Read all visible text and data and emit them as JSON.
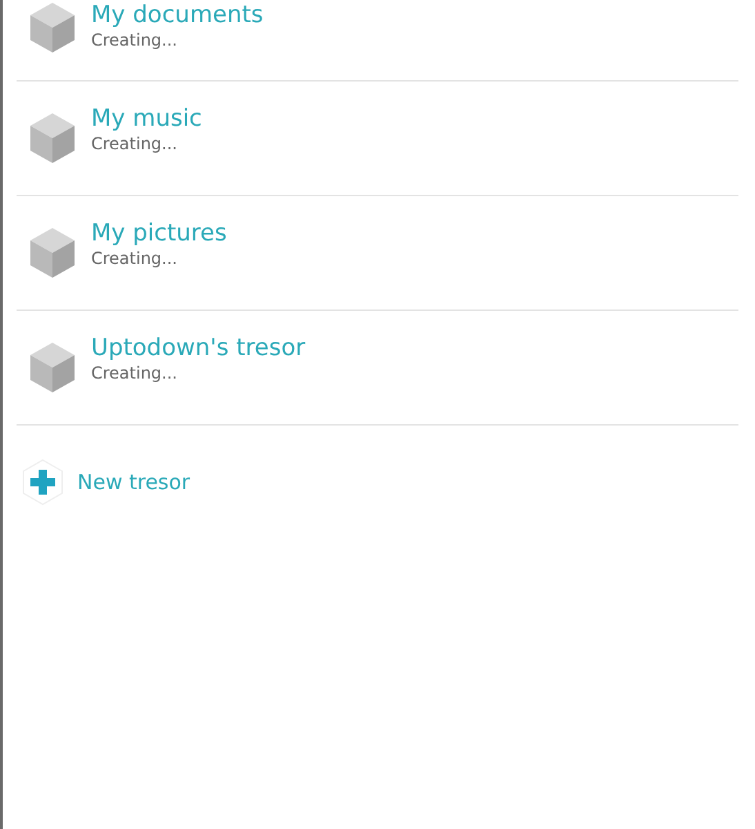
{
  "tresors": [
    {
      "name": "My documents",
      "status": "Creating..."
    },
    {
      "name": "My music",
      "status": "Creating..."
    },
    {
      "name": "My pictures",
      "status": "Creating..."
    },
    {
      "name": "Uptodown's tresor",
      "status": "Creating..."
    }
  ],
  "new_tresor": {
    "label": "New tresor"
  }
}
